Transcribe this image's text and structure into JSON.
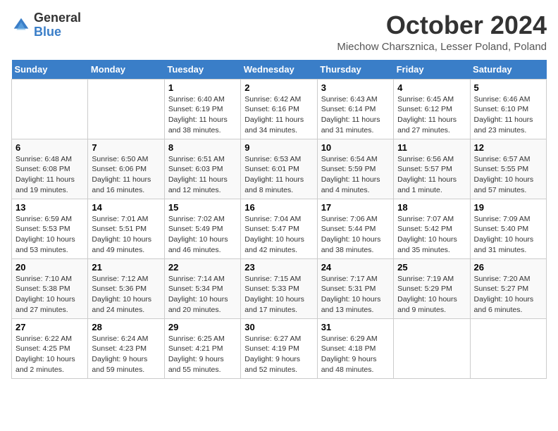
{
  "logo": {
    "text_general": "General",
    "text_blue": "Blue"
  },
  "title": {
    "month": "October 2024",
    "location": "Miechow Charsznica, Lesser Poland, Poland"
  },
  "headers": [
    "Sunday",
    "Monday",
    "Tuesday",
    "Wednesday",
    "Thursday",
    "Friday",
    "Saturday"
  ],
  "weeks": [
    [
      {
        "day": "",
        "info": ""
      },
      {
        "day": "",
        "info": ""
      },
      {
        "day": "1",
        "info": "Sunrise: 6:40 AM\nSunset: 6:19 PM\nDaylight: 11 hours and 38 minutes."
      },
      {
        "day": "2",
        "info": "Sunrise: 6:42 AM\nSunset: 6:16 PM\nDaylight: 11 hours and 34 minutes."
      },
      {
        "day": "3",
        "info": "Sunrise: 6:43 AM\nSunset: 6:14 PM\nDaylight: 11 hours and 31 minutes."
      },
      {
        "day": "4",
        "info": "Sunrise: 6:45 AM\nSunset: 6:12 PM\nDaylight: 11 hours and 27 minutes."
      },
      {
        "day": "5",
        "info": "Sunrise: 6:46 AM\nSunset: 6:10 PM\nDaylight: 11 hours and 23 minutes."
      }
    ],
    [
      {
        "day": "6",
        "info": "Sunrise: 6:48 AM\nSunset: 6:08 PM\nDaylight: 11 hours and 19 minutes."
      },
      {
        "day": "7",
        "info": "Sunrise: 6:50 AM\nSunset: 6:06 PM\nDaylight: 11 hours and 16 minutes."
      },
      {
        "day": "8",
        "info": "Sunrise: 6:51 AM\nSunset: 6:03 PM\nDaylight: 11 hours and 12 minutes."
      },
      {
        "day": "9",
        "info": "Sunrise: 6:53 AM\nSunset: 6:01 PM\nDaylight: 11 hours and 8 minutes."
      },
      {
        "day": "10",
        "info": "Sunrise: 6:54 AM\nSunset: 5:59 PM\nDaylight: 11 hours and 4 minutes."
      },
      {
        "day": "11",
        "info": "Sunrise: 6:56 AM\nSunset: 5:57 PM\nDaylight: 11 hours and 1 minute."
      },
      {
        "day": "12",
        "info": "Sunrise: 6:57 AM\nSunset: 5:55 PM\nDaylight: 10 hours and 57 minutes."
      }
    ],
    [
      {
        "day": "13",
        "info": "Sunrise: 6:59 AM\nSunset: 5:53 PM\nDaylight: 10 hours and 53 minutes."
      },
      {
        "day": "14",
        "info": "Sunrise: 7:01 AM\nSunset: 5:51 PM\nDaylight: 10 hours and 49 minutes."
      },
      {
        "day": "15",
        "info": "Sunrise: 7:02 AM\nSunset: 5:49 PM\nDaylight: 10 hours and 46 minutes."
      },
      {
        "day": "16",
        "info": "Sunrise: 7:04 AM\nSunset: 5:47 PM\nDaylight: 10 hours and 42 minutes."
      },
      {
        "day": "17",
        "info": "Sunrise: 7:06 AM\nSunset: 5:44 PM\nDaylight: 10 hours and 38 minutes."
      },
      {
        "day": "18",
        "info": "Sunrise: 7:07 AM\nSunset: 5:42 PM\nDaylight: 10 hours and 35 minutes."
      },
      {
        "day": "19",
        "info": "Sunrise: 7:09 AM\nSunset: 5:40 PM\nDaylight: 10 hours and 31 minutes."
      }
    ],
    [
      {
        "day": "20",
        "info": "Sunrise: 7:10 AM\nSunset: 5:38 PM\nDaylight: 10 hours and 27 minutes."
      },
      {
        "day": "21",
        "info": "Sunrise: 7:12 AM\nSunset: 5:36 PM\nDaylight: 10 hours and 24 minutes."
      },
      {
        "day": "22",
        "info": "Sunrise: 7:14 AM\nSunset: 5:34 PM\nDaylight: 10 hours and 20 minutes."
      },
      {
        "day": "23",
        "info": "Sunrise: 7:15 AM\nSunset: 5:33 PM\nDaylight: 10 hours and 17 minutes."
      },
      {
        "day": "24",
        "info": "Sunrise: 7:17 AM\nSunset: 5:31 PM\nDaylight: 10 hours and 13 minutes."
      },
      {
        "day": "25",
        "info": "Sunrise: 7:19 AM\nSunset: 5:29 PM\nDaylight: 10 hours and 9 minutes."
      },
      {
        "day": "26",
        "info": "Sunrise: 7:20 AM\nSunset: 5:27 PM\nDaylight: 10 hours and 6 minutes."
      }
    ],
    [
      {
        "day": "27",
        "info": "Sunrise: 6:22 AM\nSunset: 4:25 PM\nDaylight: 10 hours and 2 minutes."
      },
      {
        "day": "28",
        "info": "Sunrise: 6:24 AM\nSunset: 4:23 PM\nDaylight: 9 hours and 59 minutes."
      },
      {
        "day": "29",
        "info": "Sunrise: 6:25 AM\nSunset: 4:21 PM\nDaylight: 9 hours and 55 minutes."
      },
      {
        "day": "30",
        "info": "Sunrise: 6:27 AM\nSunset: 4:19 PM\nDaylight: 9 hours and 52 minutes."
      },
      {
        "day": "31",
        "info": "Sunrise: 6:29 AM\nSunset: 4:18 PM\nDaylight: 9 hours and 48 minutes."
      },
      {
        "day": "",
        "info": ""
      },
      {
        "day": "",
        "info": ""
      }
    ]
  ]
}
